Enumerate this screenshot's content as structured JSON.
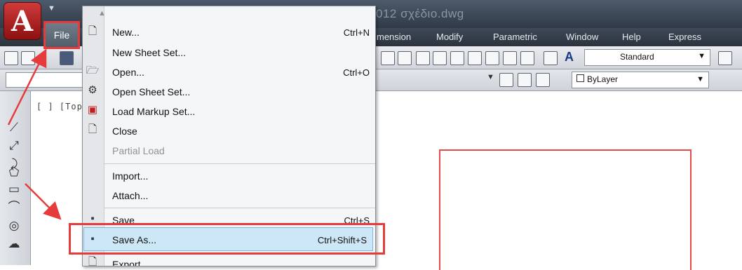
{
  "window": {
    "title": "012   σχέδιο.dwg"
  },
  "colors": {
    "highlight_red": "#e53b3b",
    "menu_hover": "#cde7f6",
    "drawing_line": "#e44b4b"
  },
  "quick_access": {
    "app_letter": "A"
  },
  "file_button": {
    "label": "File"
  },
  "menubar": {
    "items": [
      "mension",
      "Modify",
      "Parametric",
      "Window",
      "Help",
      "Express"
    ]
  },
  "toolbar": {
    "text_style": "Standard",
    "layer": "ByLayer",
    "fragment": "[ ] [Top]"
  },
  "file_menu": {
    "items": [
      {
        "label": "New...",
        "shortcut": "Ctrl+N",
        "icon": "new-file-icon"
      },
      {
        "label": "New Sheet Set...",
        "shortcut": "",
        "icon": ""
      },
      {
        "label": "Open...",
        "shortcut": "Ctrl+O",
        "icon": "open-folder-icon"
      },
      {
        "label": "Open Sheet Set...",
        "shortcut": "",
        "icon": "open-sheet-set-icon"
      },
      {
        "label": "Load Markup Set...",
        "shortcut": "",
        "icon": "markup-set-icon"
      },
      {
        "label": "Close",
        "shortcut": "",
        "icon": "close-file-icon"
      },
      {
        "label": "Partial Load",
        "shortcut": "",
        "icon": "",
        "disabled": true
      },
      {
        "label": "Import...",
        "shortcut": "",
        "icon": ""
      },
      {
        "label": "Attach...",
        "shortcut": "",
        "icon": ""
      },
      {
        "label": "Save",
        "shortcut": "Ctrl+S",
        "icon": "save-icon"
      },
      {
        "label": "Save As...",
        "shortcut": "Ctrl+Shift+S",
        "icon": "save-as-icon",
        "highlighted": true
      },
      {
        "label": "Export",
        "shortcut": "",
        "icon": "export-icon"
      }
    ]
  }
}
